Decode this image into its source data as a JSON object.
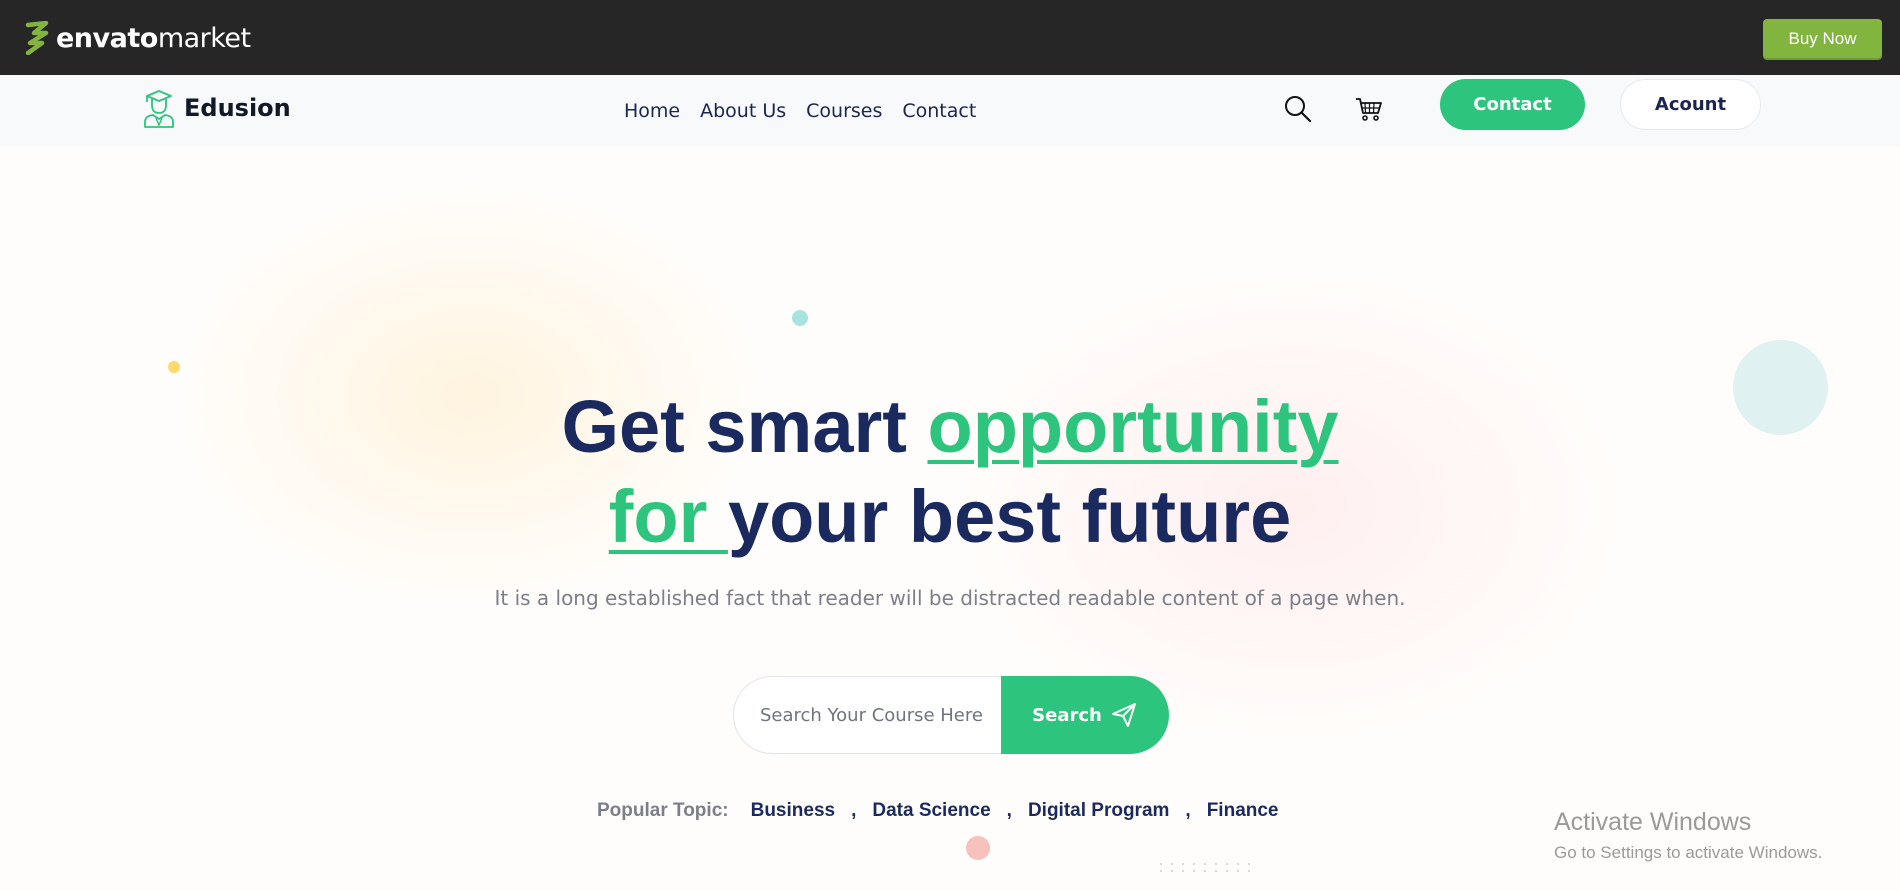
{
  "envato": {
    "logo_bold": "envato",
    "logo_light": "market",
    "buy_now": "Buy Now",
    "accent": "#82b440"
  },
  "header": {
    "brand_name": "Edusion",
    "nav": [
      "Home",
      "About Us",
      "Courses",
      "Contact"
    ],
    "contact_button": "Contact",
    "account_button": "Acount",
    "icons": [
      "search-icon",
      "cart-icon",
      "graduate-icon"
    ]
  },
  "hero": {
    "heading_part1": "Get smart ",
    "heading_highlight1": "opportunity",
    "heading_highlight2": "for ",
    "heading_part2": "your best future",
    "subtext": "It is a long established fact that reader will be distracted readable content of a page when.",
    "search_placeholder": "Search Your Course Here",
    "search_button": "Search",
    "popular_label": "Popular Topic:",
    "topics": [
      "Business",
      "Data Science",
      "Digital Program",
      "Finance"
    ]
  },
  "watermark": {
    "title": "Activate Windows",
    "subtitle": "Go to Settings to activate Windows."
  },
  "colors": {
    "primary_green": "#2dc57d",
    "navy": "#1b2a5e",
    "topbar": "#262626"
  }
}
